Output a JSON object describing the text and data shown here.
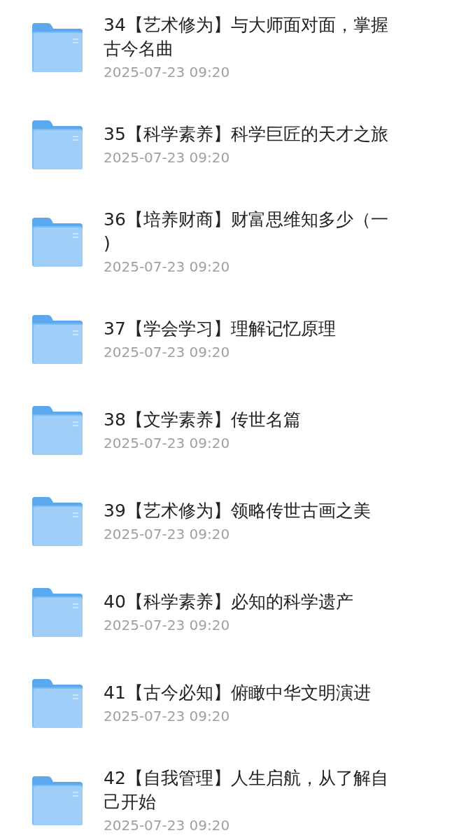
{
  "folders": [
    {
      "title_lines": [
        "34【艺术修为】与大师面对面，掌握",
        "古今名曲"
      ],
      "date": "2025-07-23 09:20"
    },
    {
      "title_lines": [
        "35【科学素养】科学巨匠的天才之旅"
      ],
      "date": "2025-07-23 09:20"
    },
    {
      "title_lines": [
        "36【培养财商】财富思维知多少（一",
        ")"
      ],
      "date": "2025-07-23 09:20"
    },
    {
      "title_lines": [
        "37【学会学习】理解记忆原理"
      ],
      "date": "2025-07-23 09:20"
    },
    {
      "title_lines": [
        "38【文学素养】传世名篇"
      ],
      "date": "2025-07-23 09:20"
    },
    {
      "title_lines": [
        "39【艺术修为】领略传世古画之美"
      ],
      "date": "2025-07-23 09:20"
    },
    {
      "title_lines": [
        "40【科学素养】必知的科学遗产"
      ],
      "date": "2025-07-23 09:20"
    },
    {
      "title_lines": [
        "41【古今必知】俯瞰中华文明演进"
      ],
      "date": "2025-07-23 09:20"
    },
    {
      "title_lines": [
        "42【自我管理】人生启航，从了解自",
        "己开始"
      ],
      "date": "2025-07-23 09:20"
    }
  ]
}
